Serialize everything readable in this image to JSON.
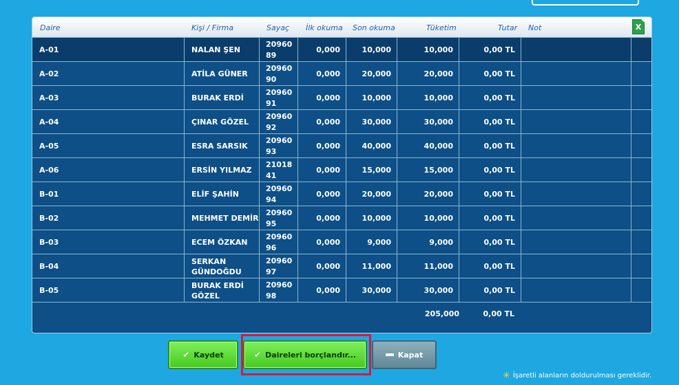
{
  "header": {
    "columns": [
      "Daire",
      "Kişi / Firma",
      "Sayaç",
      "İlk okuma",
      "Son okuma",
      "Tüketim",
      "Tutar",
      "Not"
    ],
    "excel_label": "X"
  },
  "rows": [
    {
      "daire": "A-01",
      "kisi": "NALAN ŞEN",
      "sayac": "2096089",
      "ilk": "0,000",
      "son": "10,000",
      "tuketim": "10,000",
      "tutar": "0,00 TL",
      "not": ""
    },
    {
      "daire": "A-02",
      "kisi": "ATİLA GÜNER",
      "sayac": "2096090",
      "ilk": "0,000",
      "son": "20,000",
      "tuketim": "20,000",
      "tutar": "0,00 TL",
      "not": ""
    },
    {
      "daire": "A-03",
      "kisi": "BURAK ERDİ",
      "sayac": "2096091",
      "ilk": "0,000",
      "son": "10,000",
      "tuketim": "10,000",
      "tutar": "0,00 TL",
      "not": ""
    },
    {
      "daire": "A-04",
      "kisi": "ÇINAR GÖZEL",
      "sayac": "2096092",
      "ilk": "0,000",
      "son": "30,000",
      "tuketim": "30,000",
      "tutar": "0,00 TL",
      "not": ""
    },
    {
      "daire": "A-05",
      "kisi": "ESRA SARSIK",
      "sayac": "2096093",
      "ilk": "0,000",
      "son": "40,000",
      "tuketim": "40,000",
      "tutar": "0,00 TL",
      "not": ""
    },
    {
      "daire": "A-06",
      "kisi": "ERSİN YILMAZ",
      "sayac": "2101841",
      "ilk": "0,000",
      "son": "15,000",
      "tuketim": "15,000",
      "tutar": "0,00 TL",
      "not": ""
    },
    {
      "daire": "B-01",
      "kisi": "ELİF ŞAHİN",
      "sayac": "2096094",
      "ilk": "0,000",
      "son": "20,000",
      "tuketim": "20,000",
      "tutar": "0,00 TL",
      "not": ""
    },
    {
      "daire": "B-02",
      "kisi": "MEHMET DEMİR",
      "sayac": "2096095",
      "ilk": "0,000",
      "son": "10,000",
      "tuketim": "10,000",
      "tutar": "0,00 TL",
      "not": ""
    },
    {
      "daire": "B-03",
      "kisi": "ECEM ÖZKAN",
      "sayac": "2096096",
      "ilk": "0,000",
      "son": "9,000",
      "tuketim": "9,000",
      "tutar": "0,00 TL",
      "not": ""
    },
    {
      "daire": "B-04",
      "kisi": "SERKAN GÜNDOĞDU",
      "sayac": "2096097",
      "ilk": "0,000",
      "son": "11,000",
      "tuketim": "11,000",
      "tutar": "0,00 TL",
      "not": ""
    },
    {
      "daire": "B-05",
      "kisi": "BURAK ERDİ GÖZEL",
      "sayac": "2096098",
      "ilk": "0,000",
      "son": "30,000",
      "tuketim": "30,000",
      "tutar": "0,00 TL",
      "not": ""
    }
  ],
  "totals": {
    "tuketim": "205,000",
    "tutar": "0,00 TL"
  },
  "buttons": {
    "save": "Kaydet",
    "charge": "Daireleri borçlandır...",
    "close": "Kapat"
  },
  "footnote": "İşaretli alanların doldurulması gereklidir.",
  "colors": {
    "background": "#1ea7e1",
    "grid": "#0d4f86",
    "highlight": "#d8193b",
    "green_button": "#45c91f"
  }
}
